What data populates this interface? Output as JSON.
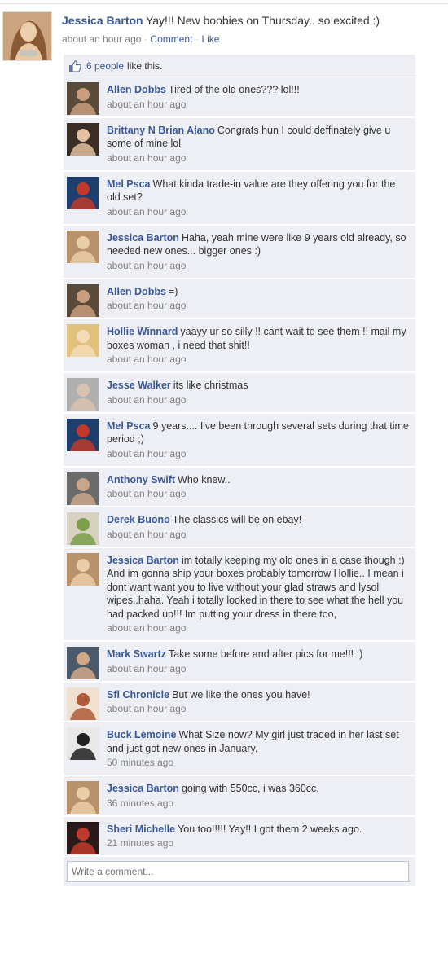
{
  "post": {
    "author": "Jessica Barton",
    "text": "Yay!!! New boobies on Thursday.. so excited :)",
    "time": "about an hour ago",
    "comment_label": "Comment",
    "like_label": "Like",
    "separator": "·"
  },
  "likes": {
    "count": "6 people",
    "suffix": "like this."
  },
  "comments": [
    {
      "author": "Allen Dobbs",
      "text": "Tired of the old ones??? lol!!!",
      "time": "about an hour ago",
      "avatar": {
        "bg": "#5a4a3a",
        "fg": "#c89c7c"
      }
    },
    {
      "author": "Brittany N Brian Alano",
      "text": "Congrats hun I could deffinately give u some of mine lol",
      "time": "about an hour ago",
      "avatar": {
        "bg": "#3a2e26",
        "fg": "#e2bfa0"
      }
    },
    {
      "author": "Mel Psca",
      "text": "What kinda trade-in value are they offering you for the old set?",
      "time": "about an hour ago",
      "avatar": {
        "bg": "#1e3e6e",
        "fg": "#c0392b"
      }
    },
    {
      "author": "Jessica Barton",
      "text": "Haha, yeah mine were like 9 years old already, so needed new ones... bigger ones :)",
      "time": "about an hour ago",
      "avatar": {
        "bg": "#b8926a",
        "fg": "#e9cda8"
      }
    },
    {
      "author": "Allen Dobbs",
      "text": "=)",
      "time": "about an hour ago",
      "avatar": {
        "bg": "#5a4a3a",
        "fg": "#c89c7c"
      }
    },
    {
      "author": "Hollie Winnard",
      "text": "yaayy ur so silly !! cant wait to see them !! mail my boxes woman , i need that shit!!",
      "time": "about an hour ago",
      "avatar": {
        "bg": "#e0c27c",
        "fg": "#f3dcb8"
      }
    },
    {
      "author": "Jesse Walker",
      "text": "its like christmas",
      "time": "about an hour ago",
      "avatar": {
        "bg": "#b0b0b0",
        "fg": "#d8c2b0"
      }
    },
    {
      "author": "Mel Psca",
      "text": "9 years.... I've been through several sets during that time period ;)",
      "time": "about an hour ago",
      "avatar": {
        "bg": "#1e3e6e",
        "fg": "#c0392b"
      }
    },
    {
      "author": "Anthony Swift",
      "text": "Who knew..",
      "time": "about an hour ago",
      "avatar": {
        "bg": "#6b6b6b",
        "fg": "#c9a68a"
      }
    },
    {
      "author": "Derek Buono",
      "text": "The classics will be on ebay!",
      "time": "about an hour ago",
      "avatar": {
        "bg": "#d8d0c0",
        "fg": "#7aa04a"
      }
    },
    {
      "author": "Jessica Barton",
      "text": "im totally keeping my old ones in a case though :)",
      "text2": "And im gonna ship your boxes probably tomorrow Hollie.. I mean i dont want want you to live without your glad straws and lysol wipes..haha. Yeah i totally looked in there to see what the hell you had packed up!!! Im putting your dress in there too,",
      "time": "about an hour ago",
      "avatar": {
        "bg": "#b8926a",
        "fg": "#e9cda8"
      }
    },
    {
      "author": "Mark Swartz",
      "text": "Take some before and after pics for me!!! :)",
      "time": "about an hour ago",
      "avatar": {
        "bg": "#4a5a6a",
        "fg": "#d0a888"
      }
    },
    {
      "author": "Sfl Chronicle",
      "text": "But we like the ones you have!",
      "time": "about an hour ago",
      "avatar": {
        "bg": "#f0e0d0",
        "fg": "#b05a3a"
      }
    },
    {
      "author": "Buck Lemoine",
      "text": "What Size now? My girl just traded in her last set and just got new ones in January.",
      "time": "50 minutes ago",
      "avatar": {
        "bg": "#e8e8e8",
        "fg": "#202020"
      }
    },
    {
      "author": "Jessica Barton",
      "text": "going with 550cc, i was 360cc.",
      "time": "36 minutes ago",
      "avatar": {
        "bg": "#b8926a",
        "fg": "#e9cda8"
      }
    },
    {
      "author": "Sheri Michelle",
      "text": "You too!!!!! Yay!! I got them 2 weeks ago.",
      "time": "21 minutes ago",
      "avatar": {
        "bg": "#2a1a1a",
        "fg": "#c0392b"
      }
    }
  ],
  "write_comment": {
    "placeholder": "Write a comment..."
  },
  "colors": {
    "link": "#3b5998",
    "comment_bg": "#edeff4",
    "meta": "#808080"
  }
}
